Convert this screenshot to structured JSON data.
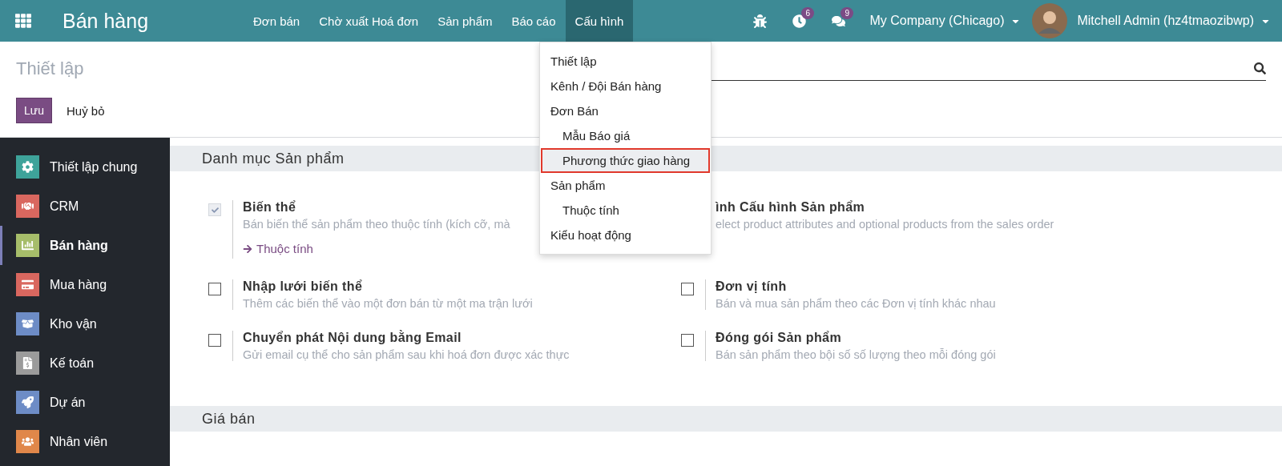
{
  "navbar": {
    "app_title": "Bán hàng",
    "menu": [
      {
        "label": "Đơn bán",
        "selected": false
      },
      {
        "label": "Chờ xuất Hoá đơn",
        "selected": false
      },
      {
        "label": "Sản phẩm",
        "selected": false
      },
      {
        "label": "Báo cáo",
        "selected": false
      },
      {
        "label": "Cấu hình",
        "selected": true
      }
    ],
    "activity_badge": "6",
    "messages_badge": "9",
    "company": "My Company (Chicago)",
    "user": "Mitchell Admin (hz4tmaozibwp)"
  },
  "dropdown": {
    "items": [
      {
        "label": "Thiết lập",
        "selected": false
      },
      {
        "label": "Kênh / Đội Bán hàng",
        "selected": false
      },
      {
        "label": "Đơn Bán",
        "selected": false,
        "children": [
          {
            "label": "Mẫu Báo giá",
            "selected": false
          },
          {
            "label": "Phương thức giao hàng",
            "selected": true
          }
        ]
      },
      {
        "label": "Sản phẩm",
        "selected": false,
        "children": [
          {
            "label": "Thuộc tính",
            "selected": false
          }
        ]
      },
      {
        "label": "Kiểu hoạt động",
        "selected": false
      }
    ]
  },
  "control_panel": {
    "title": "Thiết lập",
    "save": "Lưu",
    "discard": "Huỷ bỏ"
  },
  "sidebar": {
    "items": [
      {
        "label": "Thiết lập chung",
        "selected": false,
        "color": "#3ea39a"
      },
      {
        "label": "CRM",
        "selected": false,
        "color": "#d9675f"
      },
      {
        "label": "Bán hàng",
        "selected": true,
        "color": "#a6bd6a"
      },
      {
        "label": "Mua hàng",
        "selected": false,
        "color": "#d9675f"
      },
      {
        "label": "Kho vận",
        "selected": false,
        "color": "#6d8cc6"
      },
      {
        "label": "Kế toán",
        "selected": false,
        "color": "#9b9b9b"
      },
      {
        "label": "Dự án",
        "selected": false,
        "color": "#6d8cc6"
      },
      {
        "label": "Nhân viên",
        "selected": false,
        "color": "#e0874a"
      }
    ]
  },
  "sections": [
    {
      "title": "Danh mục Sản phẩm",
      "settings": [
        {
          "title": "Biến thể",
          "description": "Bán biến thể sản phẩm theo thuộc tính (kích cỡ, mà",
          "checked": true,
          "disabled": true,
          "link": "Thuộc tính"
        },
        {
          "title": "ình Cấu hình Sản phẩm",
          "description": "elect product attributes and optional products from the sales order"
        },
        {
          "title": "Nhập lưới biến thể",
          "description": "Thêm các biến thể vào một đơn bán từ một ma trận lưới",
          "checked": false,
          "disabled": false
        },
        {
          "title": "Đơn vị tính",
          "description": "Bán và mua sản phẩm theo các Đơn vị tính khác nhau",
          "checked": false,
          "disabled": false
        },
        {
          "title": "Chuyển phát Nội dung bằng Email",
          "description": "Gửi email cụ thể cho sản phẩm sau khi hoá đơn được xác thực",
          "checked": false,
          "disabled": false
        },
        {
          "title": "Đóng gói Sản phẩm",
          "description": "Bán sản phẩm theo bội số số lượng theo mỗi đóng gói",
          "checked": false,
          "disabled": false
        }
      ]
    },
    {
      "title": "Giá bán"
    }
  ]
}
